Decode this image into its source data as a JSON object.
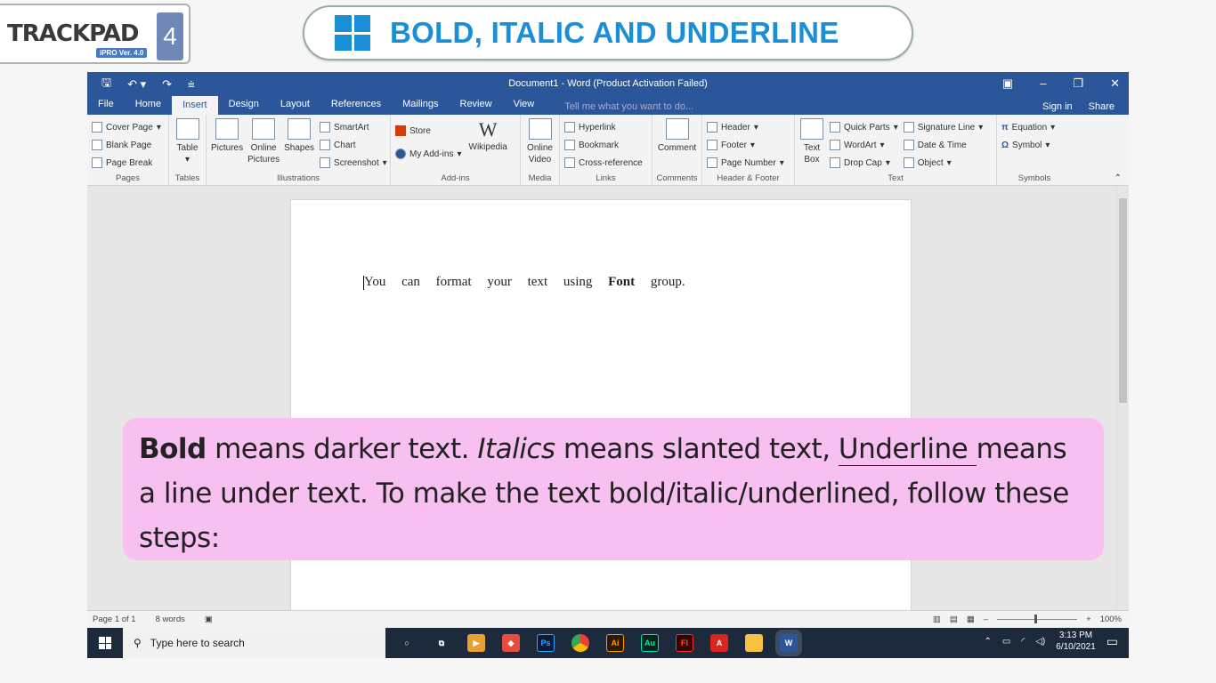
{
  "logo": {
    "text": "TRACKPAD",
    "version": "iPRO Ver. 4.0",
    "number": "4"
  },
  "slide_title": "BOLD, ITALIC AND UNDERLINE",
  "word": {
    "title": "Document1 - Word (Product Activation Failed)",
    "tabs": [
      "File",
      "Home",
      "Insert",
      "Design",
      "Layout",
      "References",
      "Mailings",
      "Review",
      "View"
    ],
    "active_tab": "Insert",
    "tell_me": "Tell me what you want to do...",
    "sign_in": "Sign in",
    "share": "Share",
    "groups": {
      "pages": {
        "label": "Pages",
        "items": [
          "Cover Page",
          "Blank Page",
          "Page Break"
        ]
      },
      "tables": {
        "label": "Tables",
        "item": "Table"
      },
      "illustrations": {
        "label": "Illustrations",
        "pictures": "Pictures",
        "online_pictures": "Online Pictures",
        "shapes": "Shapes",
        "smartart": "SmartArt",
        "chart": "Chart",
        "screenshot": "Screenshot"
      },
      "addins": {
        "label": "Add-ins",
        "store": "Store",
        "my_addins": "My Add-ins",
        "wikipedia": "Wikipedia"
      },
      "media": {
        "label": "Media",
        "online_video": "Online Video"
      },
      "links": {
        "label": "Links",
        "items": [
          "Hyperlink",
          "Bookmark",
          "Cross-reference"
        ]
      },
      "comments": {
        "label": "Comments",
        "item": "Comment"
      },
      "header_footer": {
        "label": "Header & Footer",
        "items": [
          "Header",
          "Footer",
          "Page Number"
        ]
      },
      "text": {
        "label": "Text",
        "text_box": "Text Box",
        "items": [
          "Quick Parts",
          "WordArt",
          "Drop Cap"
        ],
        "items2": [
          "Signature Line",
          "Date & Time",
          "Object"
        ]
      },
      "symbols": {
        "label": "Symbols",
        "items": [
          "Equation",
          "Symbol"
        ]
      }
    },
    "doc_text_before": "You can format your text using",
    "doc_text_bold": "Font",
    "doc_text_after": "group.",
    "status": {
      "page": "Page 1 of 1",
      "words": "8 words",
      "zoom": "100%"
    }
  },
  "taskbar": {
    "search_placeholder": "Type here to search",
    "time": "3:13 PM",
    "date": "6/10/2021"
  },
  "callout": {
    "bold": "Bold",
    "t1": " means darker text. ",
    "italic": "Italics",
    "t2": " means slanted text, ",
    "underline": "Underline ",
    "t3": "means a line under text. To make the text bold/italic/underlined, follow these steps:"
  }
}
